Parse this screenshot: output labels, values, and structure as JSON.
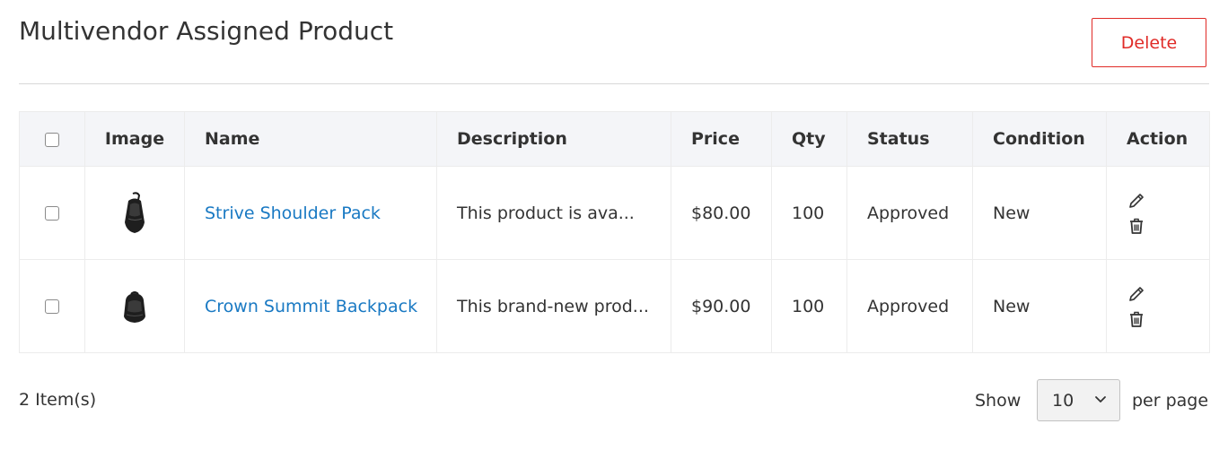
{
  "page": {
    "title": "Multivendor Assigned Product"
  },
  "toolbar": {
    "delete_label": "Delete"
  },
  "table": {
    "columns": [
      "Image",
      "Name",
      "Description",
      "Price",
      "Qty",
      "Status",
      "Condition",
      "Action"
    ],
    "rows": [
      {
        "image_icon": "shoulder-pack-image",
        "name": "Strive Shoulder Pack",
        "description": "This product is ava...",
        "price": "$80.00",
        "qty": "100",
        "status": "Approved",
        "condition": "New"
      },
      {
        "image_icon": "backpack-image",
        "name": "Crown Summit Backpack",
        "description": "This brand-new prod...",
        "price": "$90.00",
        "qty": "100",
        "status": "Approved",
        "condition": "New"
      }
    ]
  },
  "footer": {
    "item_count": "2 Item(s)",
    "show_label": "Show",
    "per_page_value": "10",
    "per_page_label": "per page"
  },
  "colors": {
    "link": "#1979c3",
    "delete": "#e02b27",
    "header_bg": "#f4f5f8",
    "border": "#ececec"
  }
}
